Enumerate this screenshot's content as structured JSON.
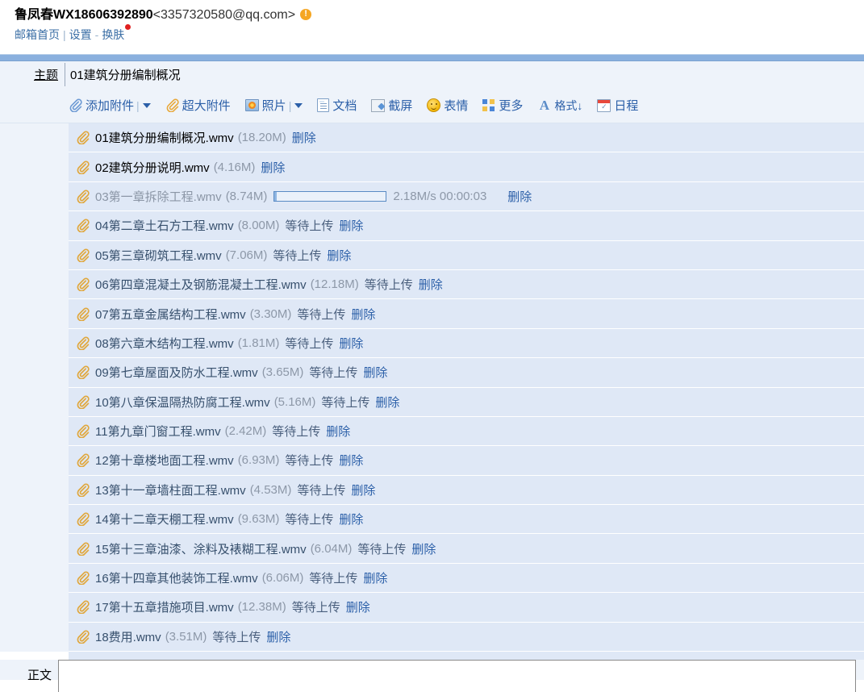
{
  "account": {
    "name": "鲁凤春WX18606392890",
    "email": "<3357320580@qq.com>",
    "warning_icon": "warning-icon",
    "links": {
      "mailbox_home": "邮箱首页",
      "divider": "|",
      "settings": "设置",
      "dash": "-",
      "skin": "换肤"
    }
  },
  "subject": {
    "label": "主题",
    "value": "01建筑分册编制概况",
    "placeholder": ""
  },
  "toolbar": {
    "items": [
      {
        "label": "添加附件",
        "icon": "paperclip-icon",
        "has_caret": true
      },
      {
        "label": "超大附件",
        "icon": "paperclip-icon",
        "has_caret": false
      },
      {
        "label": "照片",
        "icon": "photo-icon",
        "has_caret": true
      },
      {
        "label": "文档",
        "icon": "document-icon",
        "has_caret": false
      },
      {
        "label": "截屏",
        "icon": "screenshot-icon",
        "has_caret": false
      },
      {
        "label": "表情",
        "icon": "smiley-icon",
        "has_caret": false
      },
      {
        "label": "更多",
        "icon": "grid-more-icon",
        "has_caret": false
      },
      {
        "label": "格式↓",
        "icon": "format-icon",
        "has_caret": false
      },
      {
        "label": "日程",
        "icon": "calendar-icon",
        "has_caret": false
      }
    ]
  },
  "attachments": {
    "delete_label": "删除",
    "pending_label": "等待上传",
    "rows": [
      {
        "name": "01建筑分册编制概况.wmv",
        "size": "(18.20M)",
        "status": "",
        "state": "done"
      },
      {
        "name": "02建筑分册说明.wmv",
        "size": "(4.16M)",
        "status": "",
        "state": "done"
      },
      {
        "name": "03第一章拆除工程.wmv",
        "size": "(8.74M)",
        "status": "",
        "state": "uploading",
        "progress_percent": 2,
        "speed": "2.18M/s 00:00:03"
      },
      {
        "name": "04第二章土石方工程.wmv",
        "size": "(8.00M)",
        "status": "等待上传",
        "state": "pending"
      },
      {
        "name": "05第三章砌筑工程.wmv",
        "size": "(7.06M)",
        "status": "等待上传",
        "state": "pending"
      },
      {
        "name": "06第四章混凝土及钢筋混凝土工程.wmv",
        "size": "(12.18M)",
        "status": "等待上传",
        "state": "pending"
      },
      {
        "name": "07第五章金属结构工程.wmv",
        "size": "(3.30M)",
        "status": "等待上传",
        "state": "pending"
      },
      {
        "name": "08第六章木结构工程.wmv",
        "size": "(1.81M)",
        "status": "等待上传",
        "state": "pending"
      },
      {
        "name": "09第七章屋面及防水工程.wmv",
        "size": "(3.65M)",
        "status": "等待上传",
        "state": "pending"
      },
      {
        "name": "10第八章保温隔热防腐工程.wmv",
        "size": "(5.16M)",
        "status": "等待上传",
        "state": "pending"
      },
      {
        "name": "11第九章门窗工程.wmv",
        "size": "(2.42M)",
        "status": "等待上传",
        "state": "pending"
      },
      {
        "name": "12第十章楼地面工程.wmv",
        "size": "(6.93M)",
        "status": "等待上传",
        "state": "pending"
      },
      {
        "name": "13第十一章墙柱面工程.wmv",
        "size": "(4.53M)",
        "status": "等待上传",
        "state": "pending"
      },
      {
        "name": "14第十二章天棚工程.wmv",
        "size": "(9.63M)",
        "status": "等待上传",
        "state": "pending"
      },
      {
        "name": "15第十三章油漆、涂料及裱糊工程.wmv",
        "size": "(6.04M)",
        "status": "等待上传",
        "state": "pending"
      },
      {
        "name": "16第十四章其他装饰工程.wmv",
        "size": "(6.06M)",
        "status": "等待上传",
        "state": "pending"
      },
      {
        "name": "17第十五章措施项目.wmv",
        "size": "(12.38M)",
        "status": "等待上传",
        "state": "pending"
      },
      {
        "name": "18费用.wmv",
        "size": "(3.51M)",
        "status": "等待上传",
        "state": "pending"
      }
    ]
  },
  "body": {
    "label": "正文",
    "value": ""
  },
  "colors": {
    "accent_blue": "#8ab0de",
    "link_blue": "#2b5fa8",
    "row_bg": "#dfe8f6",
    "panel_bg": "#eef3fa",
    "warning_orange": "#f5a623",
    "skin_dot_red": "#e02020"
  }
}
